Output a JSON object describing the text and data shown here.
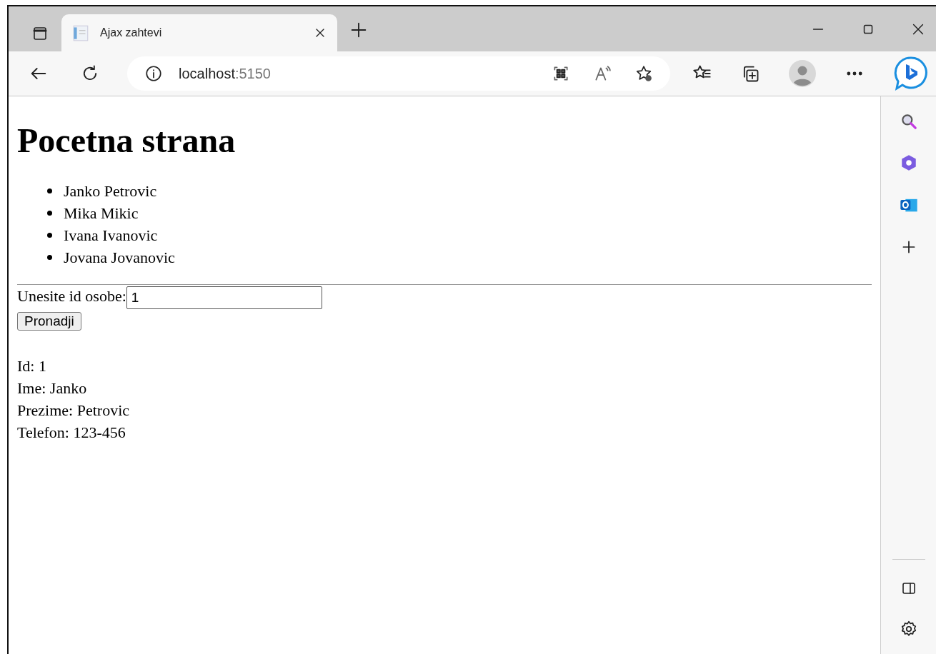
{
  "tab": {
    "title": "Ajax zahtevi",
    "selected": true
  },
  "address": {
    "host": "localhost",
    "port": ":5150"
  },
  "page": {
    "heading": "Pocetna strana",
    "people": [
      "Janko Petrovic",
      "Mika Mikic",
      "Ivana Ivanovic",
      "Jovana Jovanovic"
    ],
    "form": {
      "label": "Unesite id osobe:",
      "value": "1",
      "button": "Pronadji"
    },
    "result": [
      "Id: 1",
      "Ime: Janko",
      "Prezime: Petrovic",
      "Telefon: 123-456"
    ]
  }
}
